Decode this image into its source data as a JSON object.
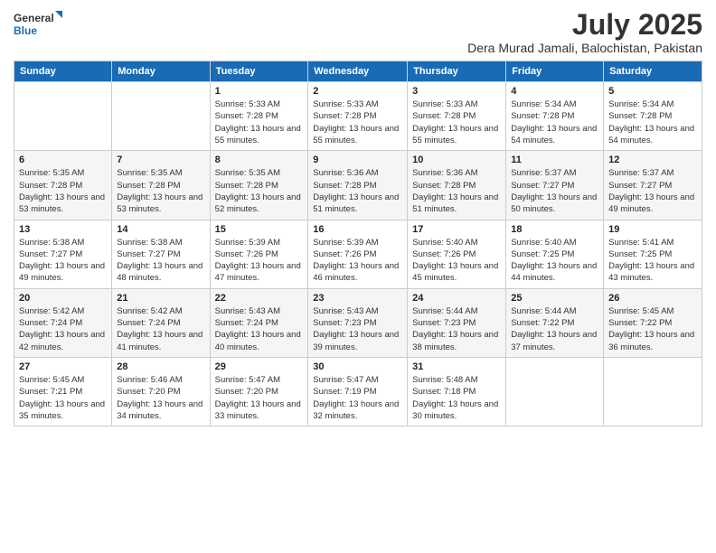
{
  "logo": {
    "line1": "General",
    "line2": "Blue"
  },
  "title": "July 2025",
  "subtitle": "Dera Murad Jamali, Balochistan, Pakistan",
  "days_of_week": [
    "Sunday",
    "Monday",
    "Tuesday",
    "Wednesday",
    "Thursday",
    "Friday",
    "Saturday"
  ],
  "weeks": [
    [
      {
        "day": "",
        "sunrise": "",
        "sunset": "",
        "daylight": ""
      },
      {
        "day": "",
        "sunrise": "",
        "sunset": "",
        "daylight": ""
      },
      {
        "day": "1",
        "sunrise": "Sunrise: 5:33 AM",
        "sunset": "Sunset: 7:28 PM",
        "daylight": "Daylight: 13 hours and 55 minutes."
      },
      {
        "day": "2",
        "sunrise": "Sunrise: 5:33 AM",
        "sunset": "Sunset: 7:28 PM",
        "daylight": "Daylight: 13 hours and 55 minutes."
      },
      {
        "day": "3",
        "sunrise": "Sunrise: 5:33 AM",
        "sunset": "Sunset: 7:28 PM",
        "daylight": "Daylight: 13 hours and 55 minutes."
      },
      {
        "day": "4",
        "sunrise": "Sunrise: 5:34 AM",
        "sunset": "Sunset: 7:28 PM",
        "daylight": "Daylight: 13 hours and 54 minutes."
      },
      {
        "day": "5",
        "sunrise": "Sunrise: 5:34 AM",
        "sunset": "Sunset: 7:28 PM",
        "daylight": "Daylight: 13 hours and 54 minutes."
      }
    ],
    [
      {
        "day": "6",
        "sunrise": "Sunrise: 5:35 AM",
        "sunset": "Sunset: 7:28 PM",
        "daylight": "Daylight: 13 hours and 53 minutes."
      },
      {
        "day": "7",
        "sunrise": "Sunrise: 5:35 AM",
        "sunset": "Sunset: 7:28 PM",
        "daylight": "Daylight: 13 hours and 53 minutes."
      },
      {
        "day": "8",
        "sunrise": "Sunrise: 5:35 AM",
        "sunset": "Sunset: 7:28 PM",
        "daylight": "Daylight: 13 hours and 52 minutes."
      },
      {
        "day": "9",
        "sunrise": "Sunrise: 5:36 AM",
        "sunset": "Sunset: 7:28 PM",
        "daylight": "Daylight: 13 hours and 51 minutes."
      },
      {
        "day": "10",
        "sunrise": "Sunrise: 5:36 AM",
        "sunset": "Sunset: 7:28 PM",
        "daylight": "Daylight: 13 hours and 51 minutes."
      },
      {
        "day": "11",
        "sunrise": "Sunrise: 5:37 AM",
        "sunset": "Sunset: 7:27 PM",
        "daylight": "Daylight: 13 hours and 50 minutes."
      },
      {
        "day": "12",
        "sunrise": "Sunrise: 5:37 AM",
        "sunset": "Sunset: 7:27 PM",
        "daylight": "Daylight: 13 hours and 49 minutes."
      }
    ],
    [
      {
        "day": "13",
        "sunrise": "Sunrise: 5:38 AM",
        "sunset": "Sunset: 7:27 PM",
        "daylight": "Daylight: 13 hours and 49 minutes."
      },
      {
        "day": "14",
        "sunrise": "Sunrise: 5:38 AM",
        "sunset": "Sunset: 7:27 PM",
        "daylight": "Daylight: 13 hours and 48 minutes."
      },
      {
        "day": "15",
        "sunrise": "Sunrise: 5:39 AM",
        "sunset": "Sunset: 7:26 PM",
        "daylight": "Daylight: 13 hours and 47 minutes."
      },
      {
        "day": "16",
        "sunrise": "Sunrise: 5:39 AM",
        "sunset": "Sunset: 7:26 PM",
        "daylight": "Daylight: 13 hours and 46 minutes."
      },
      {
        "day": "17",
        "sunrise": "Sunrise: 5:40 AM",
        "sunset": "Sunset: 7:26 PM",
        "daylight": "Daylight: 13 hours and 45 minutes."
      },
      {
        "day": "18",
        "sunrise": "Sunrise: 5:40 AM",
        "sunset": "Sunset: 7:25 PM",
        "daylight": "Daylight: 13 hours and 44 minutes."
      },
      {
        "day": "19",
        "sunrise": "Sunrise: 5:41 AM",
        "sunset": "Sunset: 7:25 PM",
        "daylight": "Daylight: 13 hours and 43 minutes."
      }
    ],
    [
      {
        "day": "20",
        "sunrise": "Sunrise: 5:42 AM",
        "sunset": "Sunset: 7:24 PM",
        "daylight": "Daylight: 13 hours and 42 minutes."
      },
      {
        "day": "21",
        "sunrise": "Sunrise: 5:42 AM",
        "sunset": "Sunset: 7:24 PM",
        "daylight": "Daylight: 13 hours and 41 minutes."
      },
      {
        "day": "22",
        "sunrise": "Sunrise: 5:43 AM",
        "sunset": "Sunset: 7:24 PM",
        "daylight": "Daylight: 13 hours and 40 minutes."
      },
      {
        "day": "23",
        "sunrise": "Sunrise: 5:43 AM",
        "sunset": "Sunset: 7:23 PM",
        "daylight": "Daylight: 13 hours and 39 minutes."
      },
      {
        "day": "24",
        "sunrise": "Sunrise: 5:44 AM",
        "sunset": "Sunset: 7:23 PM",
        "daylight": "Daylight: 13 hours and 38 minutes."
      },
      {
        "day": "25",
        "sunrise": "Sunrise: 5:44 AM",
        "sunset": "Sunset: 7:22 PM",
        "daylight": "Daylight: 13 hours and 37 minutes."
      },
      {
        "day": "26",
        "sunrise": "Sunrise: 5:45 AM",
        "sunset": "Sunset: 7:22 PM",
        "daylight": "Daylight: 13 hours and 36 minutes."
      }
    ],
    [
      {
        "day": "27",
        "sunrise": "Sunrise: 5:45 AM",
        "sunset": "Sunset: 7:21 PM",
        "daylight": "Daylight: 13 hours and 35 minutes."
      },
      {
        "day": "28",
        "sunrise": "Sunrise: 5:46 AM",
        "sunset": "Sunset: 7:20 PM",
        "daylight": "Daylight: 13 hours and 34 minutes."
      },
      {
        "day": "29",
        "sunrise": "Sunrise: 5:47 AM",
        "sunset": "Sunset: 7:20 PM",
        "daylight": "Daylight: 13 hours and 33 minutes."
      },
      {
        "day": "30",
        "sunrise": "Sunrise: 5:47 AM",
        "sunset": "Sunset: 7:19 PM",
        "daylight": "Daylight: 13 hours and 32 minutes."
      },
      {
        "day": "31",
        "sunrise": "Sunrise: 5:48 AM",
        "sunset": "Sunset: 7:18 PM",
        "daylight": "Daylight: 13 hours and 30 minutes."
      },
      {
        "day": "",
        "sunrise": "",
        "sunset": "",
        "daylight": ""
      },
      {
        "day": "",
        "sunrise": "",
        "sunset": "",
        "daylight": ""
      }
    ]
  ]
}
